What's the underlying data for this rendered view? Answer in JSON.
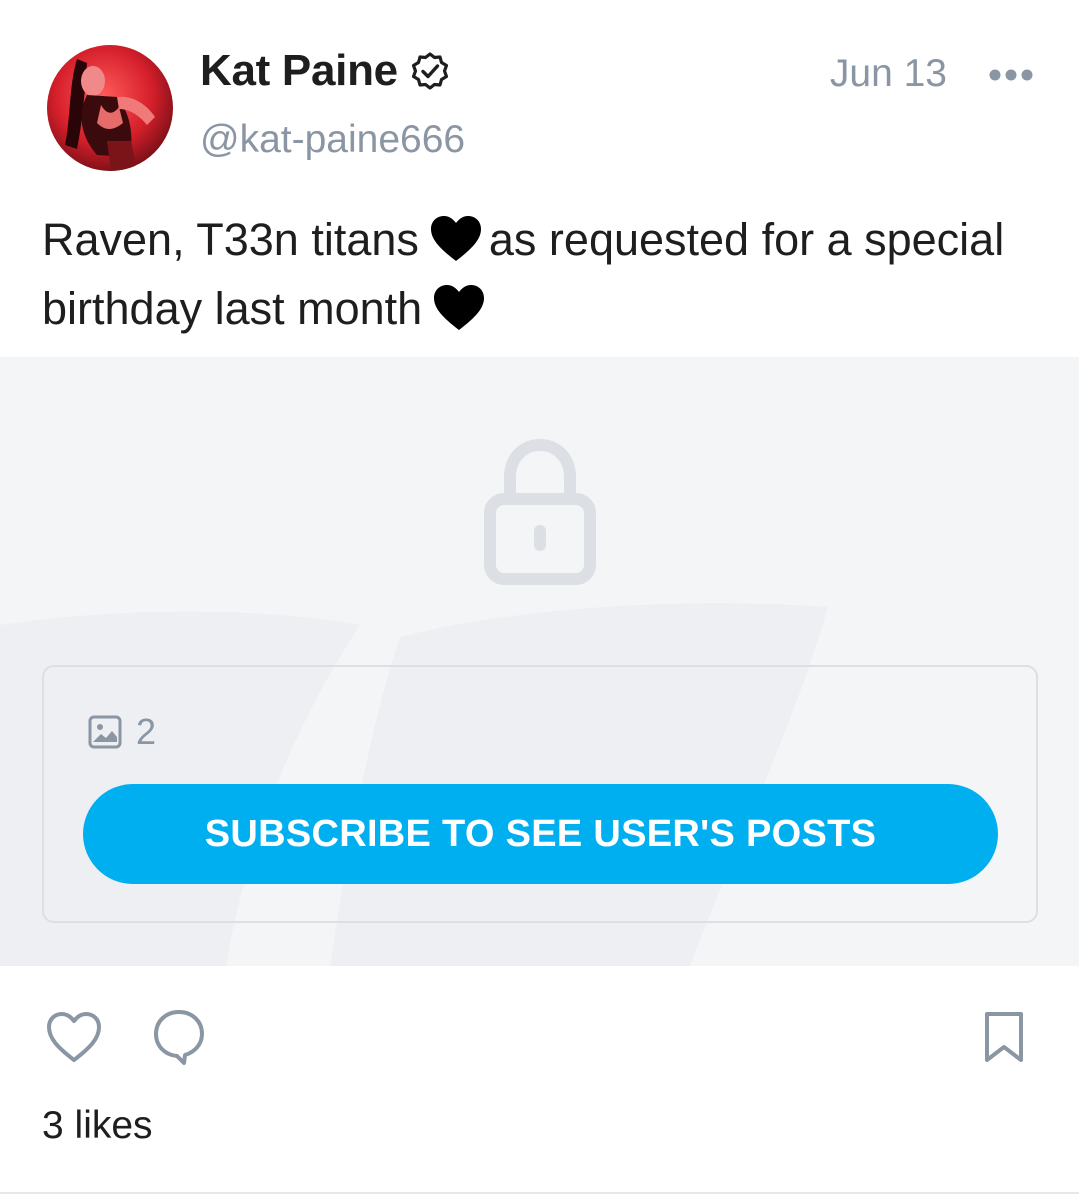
{
  "author": {
    "name": "Kat Paine",
    "handle": "@kat-paine666",
    "verified": true
  },
  "post": {
    "date": "Jun 13",
    "text_line1_before": "Raven, T33n titans",
    "text_line1_after": "as requested for a special",
    "text_line2": "birthday last month",
    "emoji": "black-heart"
  },
  "locked": {
    "media_count": "2",
    "subscribe_label": "SUBSCRIBE TO SEE USER'S POSTS"
  },
  "footer": {
    "likes_label": "3 likes"
  },
  "colors": {
    "accent": "#00aff0",
    "muted_text": "#8a96a3",
    "locked_bg": "#f4f5f7"
  },
  "icons": [
    "verified-badge-icon",
    "more-icon",
    "lock-icon",
    "image-icon",
    "like-icon",
    "comment-icon",
    "bookmark-icon"
  ]
}
